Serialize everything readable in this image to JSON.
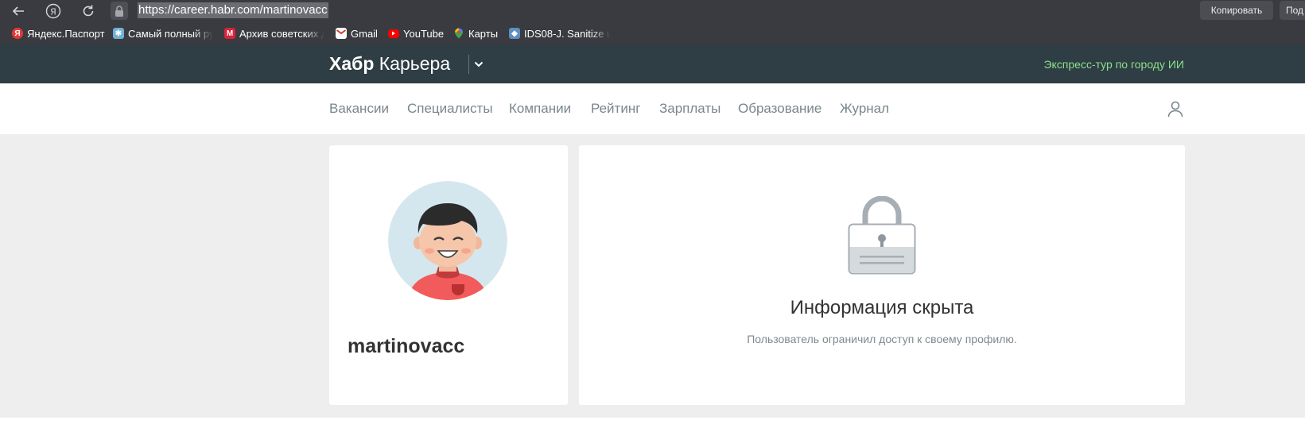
{
  "browser": {
    "url": "https://career.habr.com/martinovacc",
    "copy_button": "Копировать",
    "extra_button": "Под",
    "bookmarks": [
      {
        "label": "Яндекс.Паспорт",
        "icon": "yandex-icon"
      },
      {
        "label": "Самый полный ру",
        "icon": "snowflake-icon"
      },
      {
        "label": "Архив советских д",
        "icon": "m-icon"
      },
      {
        "label": "Gmail",
        "icon": "gmail-icon"
      },
      {
        "label": "YouTube",
        "icon": "youtube-icon"
      },
      {
        "label": "Карты",
        "icon": "maps-icon"
      },
      {
        "label": "IDS08-J. Sanitize u",
        "icon": "ids-icon"
      }
    ]
  },
  "header": {
    "logo_bold": "Хабр",
    "logo_light": "Карьера",
    "promo": "Экспресс-тур по городу ИИ"
  },
  "nav": {
    "items": [
      "Вакансии",
      "Специалисты",
      "Компании",
      "Рейтинг",
      "Зарплаты",
      "Образование",
      "Журнал"
    ]
  },
  "profile": {
    "username": "martinovacc"
  },
  "hidden": {
    "title": "Информация скрыта",
    "description": "Пользователь ограничил доступ к своему профилю."
  },
  "colors": {
    "header_bg": "#2f3d44",
    "promo_green": "#8ce08b",
    "nav_text": "#79868c",
    "content_bg": "#eeeeee"
  }
}
